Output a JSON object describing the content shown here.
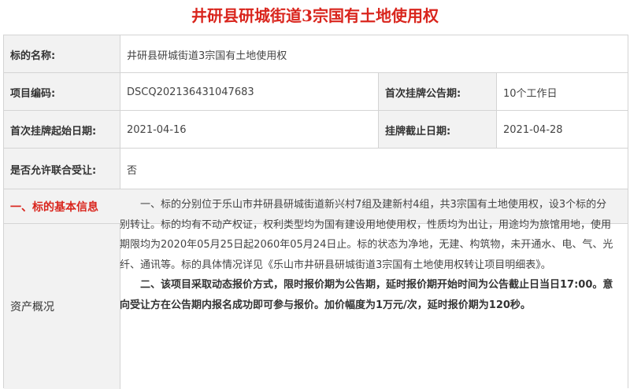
{
  "title": "井研县研城街道3宗国有土地使用权",
  "rows": {
    "name_label": "标的名称:",
    "name_value": "井研县研城街道3宗国有土地使用权",
    "code_label": "项目编码:",
    "code_value": "DSCQ202136431047683",
    "period_label": "首次挂牌公告期:",
    "period_value": "10个工作日",
    "start_label": "首次挂牌起始日期:",
    "start_value": "2021-04-16",
    "end_label": "挂牌截止日期:",
    "end_value": "2021-04-28",
    "joint_label": "是否允许联合受让:",
    "joint_value": "否"
  },
  "section_title": "一、标的基本信息",
  "asset": {
    "label": "资产概况",
    "para1": "一、标的分别位于乐山市井研县研城街道新兴村7组及建新村4组，共3宗国有土地使用权，设3个标的分别转让。标的均有不动产权证，权利类型均为国有建设用地使用权，性质均为出让，用途均为旅馆用地，使用期限均为2020年05月25日起2060年05月24日止。标的状态为净地，无建、构筑物，未开通水、电、气、光纤、通讯等。标的具体情况详见《乐山市井研县研城街道3宗国有土地使用权转让项目明细表》。",
    "para2": "二、该项目采取动态报价方式，限时报价期为公告期，延时报价期开始时间为公告截止日当日17:00。意向受让方在公告期内报名成功即可参与报价。加价幅度为1万元/次，延时报价期为120秒。"
  }
}
